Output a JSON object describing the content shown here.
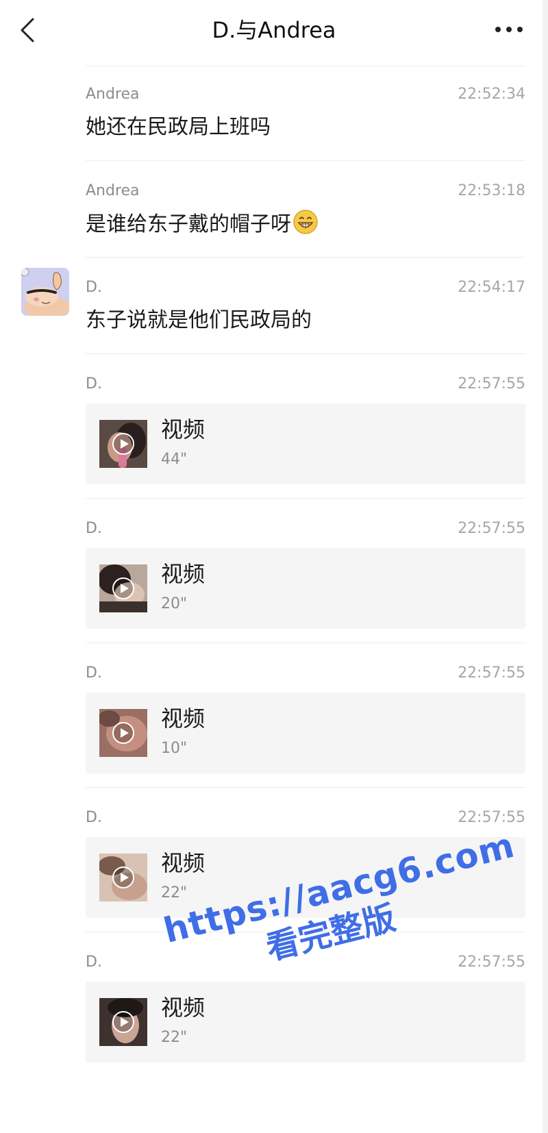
{
  "header": {
    "title": "D.与Andrea",
    "back_icon": "chevron-left-icon",
    "more_icon": "more-dots-icon"
  },
  "messages": [
    {
      "sender": "Andrea",
      "time": "22:52:34",
      "text": "她还在民政局上班吗"
    },
    {
      "sender": "Andrea",
      "time": "22:53:18",
      "text": "是谁给东子戴的帽子呀",
      "emoji": "grin-emoji-icon"
    },
    {
      "sender": "D.",
      "time": "22:54:17",
      "text": "东子说就是他们民政局的",
      "avatar": "cartoon-avatar"
    },
    {
      "sender": "D.",
      "time": "22:57:55",
      "video_label": "视频",
      "duration": "44\""
    },
    {
      "sender": "D.",
      "time": "22:57:55",
      "video_label": "视频",
      "duration": "20\""
    },
    {
      "sender": "D.",
      "time": "22:57:55",
      "video_label": "视频",
      "duration": "10\""
    },
    {
      "sender": "D.",
      "time": "22:57:55",
      "video_label": "视频",
      "duration": "22\""
    },
    {
      "sender": "D.",
      "time": "22:57:55",
      "video_label": "视频",
      "duration": "22\""
    }
  ],
  "watermark": {
    "url": "https://aacg6.com",
    "subtitle": "看完整版",
    "color": "#3f6ee6"
  },
  "colors": {
    "background": "#ffffff",
    "card": "#f5f5f5",
    "secondary_text": "#8c8c8c",
    "time_text": "#a6a6a6"
  }
}
